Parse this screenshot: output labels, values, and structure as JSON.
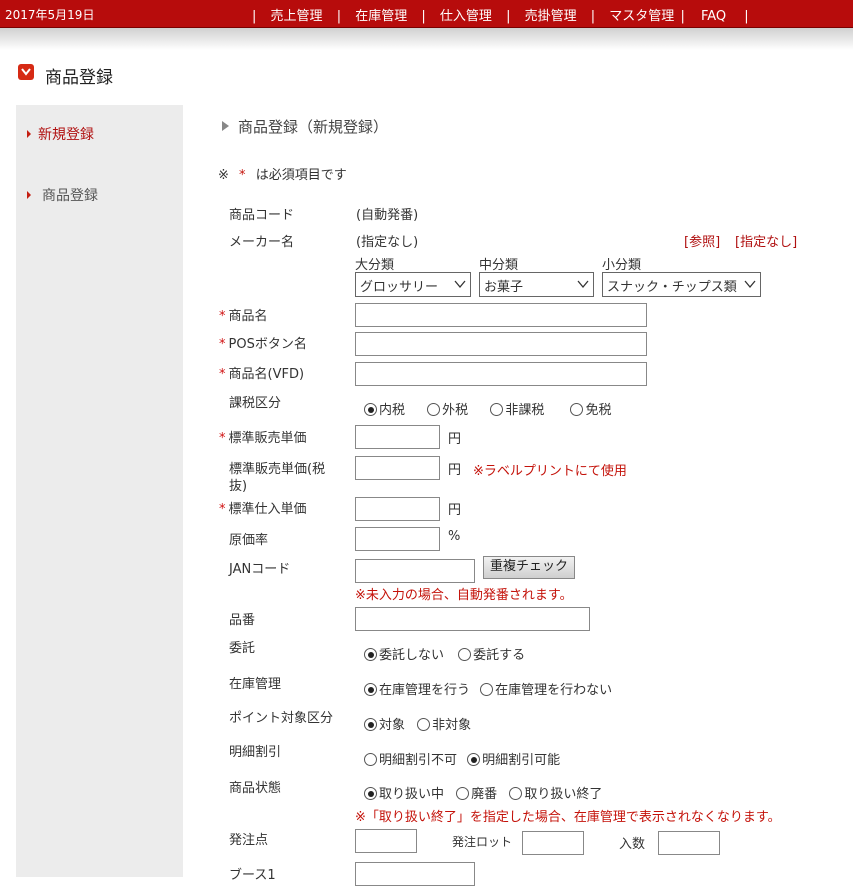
{
  "header": {
    "date": "2017年5月19日",
    "nav": [
      "売上管理",
      "在庫管理",
      "仕入管理",
      "売掛管理",
      "マスタ管理",
      "FAQ"
    ],
    "separator": "|"
  },
  "page": {
    "title": "商品登録"
  },
  "sidebar": {
    "items": [
      {
        "label": "新規登録"
      },
      {
        "label": "商品登録"
      }
    ]
  },
  "section": {
    "title": "商品登録（新規登録）"
  },
  "note": {
    "prefix": "※",
    "asterisk": "*",
    "text": "は必須項目です"
  },
  "form": {
    "product_code": {
      "label": "商品コード",
      "value": "(自動発番)"
    },
    "maker": {
      "label": "メーカー名",
      "value": "(指定なし)",
      "ref_link": "[参照]",
      "none_link": "[指定なし]"
    },
    "categories": {
      "large": {
        "label": "大分類",
        "value": "グロッサリー"
      },
      "medium": {
        "label": "中分類",
        "value": "お菓子"
      },
      "small": {
        "label": "小分類",
        "value": "スナック・チップス類"
      }
    },
    "required_mark": "*",
    "product_name": {
      "label": "商品名",
      "value": ""
    },
    "pos_button_name": {
      "label": "POSボタン名",
      "value": ""
    },
    "vfd_name": {
      "label": "商品名(VFD)",
      "value": ""
    },
    "tax_type": {
      "label": "課税区分",
      "options": [
        "内税",
        "外税",
        "非課税",
        "免税"
      ],
      "selected": 0
    },
    "std_price": {
      "label": "標準販売単価",
      "unit": "円",
      "value": ""
    },
    "std_price_excl": {
      "label_line1": "標準販売単価(税",
      "label_line2": "抜)",
      "unit": "円",
      "note": "※ラベルプリントにて使用",
      "value": ""
    },
    "std_cost": {
      "label": "標準仕入単価",
      "unit": "円",
      "value": ""
    },
    "cost_rate": {
      "label": "原価率",
      "unit": "%",
      "value": ""
    },
    "jan": {
      "label": "JANコード",
      "value": "",
      "button": "重複チェック",
      "note": "※未入力の場合、自動発番されます。"
    },
    "item_no": {
      "label": "品番",
      "value": ""
    },
    "consign": {
      "label": "委託",
      "options": [
        "委託しない",
        "委託する"
      ],
      "selected": 0
    },
    "stock_mgmt": {
      "label": "在庫管理",
      "options": [
        "在庫管理を行う",
        "在庫管理を行わない"
      ],
      "selected": 0
    },
    "points": {
      "label": "ポイント対象区分",
      "options": [
        "対象",
        "非対象"
      ],
      "selected": 0
    },
    "itemized_discount": {
      "label": "明細割引",
      "options": [
        "明細割引不可",
        "明細割引可能"
      ],
      "selected": 1
    },
    "status": {
      "label": "商品状態",
      "options": [
        "取り扱い中",
        "廃番",
        "取り扱い終了"
      ],
      "selected": 0,
      "note": "※「取り扱い終了」を指定した場合、在庫管理で表示されなくなります。"
    },
    "reorder_point": {
      "label": "発注点",
      "value": ""
    },
    "order_lot": {
      "label": "発注ロット",
      "value": ""
    },
    "quantity": {
      "label": "入数",
      "value": ""
    },
    "booth1": {
      "label": "ブース1",
      "value": ""
    }
  },
  "colors": {
    "header_bg": "#b70c0c",
    "accent": "#c4120a",
    "sidebar_bg": "#ececec"
  }
}
